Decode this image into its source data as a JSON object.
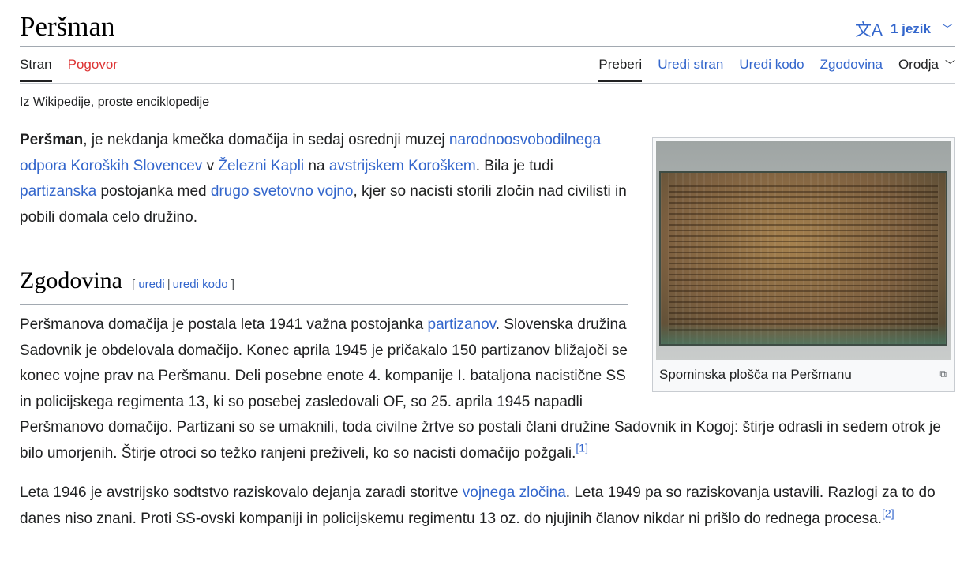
{
  "page": {
    "title": "Peršman",
    "language_button": {
      "icon": "translate-icon",
      "label": "1 jezik"
    },
    "tabs_left": [
      "Stran",
      "Pogovor"
    ],
    "tabs_right": [
      "Preberi",
      "Uredi stran",
      "Uredi kodo",
      "Zgodovina",
      "Orodja"
    ],
    "tagline": "Iz Wikipedije, proste enciklopedije"
  },
  "infobox": {
    "caption": "Spominska plošča na Peršmanu"
  },
  "intro": {
    "bold": "Peršman",
    "t1": ", je nekdanja kmečka domačija in sedaj osrednji muzej ",
    "l1": "narodnoosvobodilnega odpora Koroških Slovencev",
    "t2": " v ",
    "l2": "Železni Kapli",
    "t3": " na ",
    "l3": "avstrijskem Koroškem",
    "t4": ". Bila je tudi ",
    "l4": "partizanska",
    "t5": " postojanka med ",
    "l5": "drugo svetovno vojno",
    "t6": ", kjer so nacisti storili zločin nad civilisti in pobili domala celo družino."
  },
  "section": {
    "title": "Zgodovina",
    "edit": "uredi",
    "edit_code": "uredi kodo"
  },
  "para1": {
    "t1": "Peršmanova domačija je postala leta 1941 važna postojanka ",
    "l1": "partizanov",
    "t2": ". Slovenska družina Sadovnik je obdelovala domačijo. Konec aprila 1945 je pričakalo 150 partizanov bližajoči se konec vojne prav na Peršmanu. Deli posebne enote 4. kompanije I. bataljona nacistične SS in policijskega regimenta 13, ki so posebej zasledovali OF, so 25. aprila 1945 napadli Peršmanovo domačijo. Partizani so se umaknili, toda civilne žrtve so postali člani družine Sadovnik in Kogoj: štirje odrasli in sedem otrok je bilo umorjenih. Štirje otroci so težko ranjeni preživeli, ko so nacisti domačijo požgali.",
    "ref": "[1]"
  },
  "para2": {
    "t1": "Leta 1946 je avstrijsko sodtstvo raziskovalo dejanja zaradi storitve ",
    "l1": "vojnega zločina",
    "t2": ". Leta 1949 pa so raziskovanja ustavili. Razlogi za to do danes niso znani. Proti SS-ovski kompaniji in policijskemu regimentu 13 oz. do njujinih članov nikdar ni prišlo do rednega procesa.",
    "ref": "[2]"
  }
}
